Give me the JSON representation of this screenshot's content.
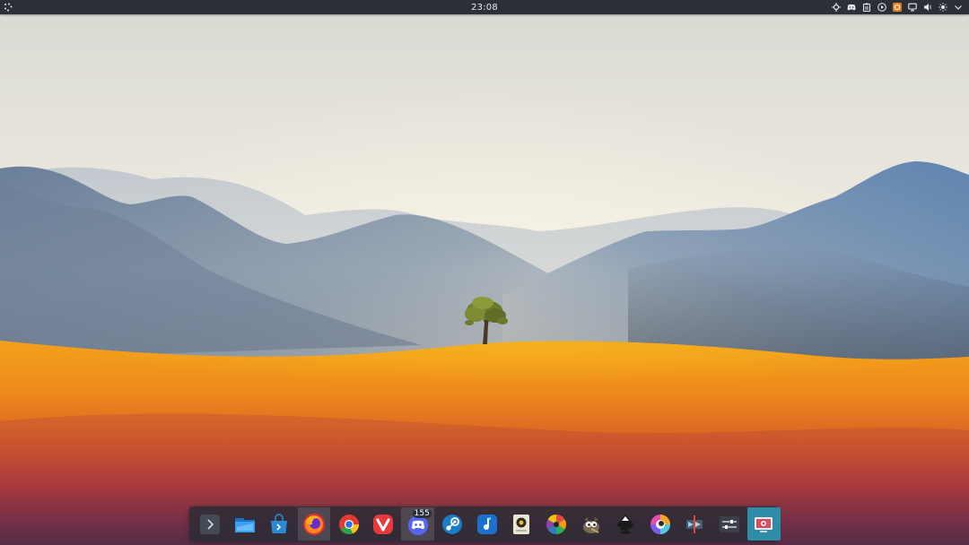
{
  "top_panel": {
    "clock": "23:08",
    "background": "#2b3036",
    "tray_icons": [
      "network-icon",
      "discord-tray-icon",
      "clipboard-icon",
      "media-player-icon",
      "orange-app-tray-icon",
      "display-icon",
      "volume-icon",
      "brightness-icon",
      "chevron-down-icon"
    ]
  },
  "dock": {
    "items": [
      {
        "name": "show-more-icon",
        "active": false
      },
      {
        "name": "file-manager-icon",
        "active": false
      },
      {
        "name": "app-store-icon",
        "active": false
      },
      {
        "name": "firefox-icon",
        "active": true
      },
      {
        "name": "chrome-icon",
        "active": false
      },
      {
        "name": "vivaldi-icon",
        "active": false
      },
      {
        "name": "discord-icon",
        "active": true,
        "badge": "155"
      },
      {
        "name": "steam-icon",
        "active": false
      },
      {
        "name": "music-app-icon",
        "active": false
      },
      {
        "name": "rhythmbox-icon",
        "active": false
      },
      {
        "name": "aperture-icon",
        "active": false
      },
      {
        "name": "gimp-icon",
        "active": false
      },
      {
        "name": "inkscape-icon",
        "active": false
      },
      {
        "name": "color-picker-icon",
        "active": false
      },
      {
        "name": "video-editor-icon",
        "active": false
      },
      {
        "name": "settings-sliders-icon",
        "active": false
      },
      {
        "name": "screenshot-tool-icon",
        "active": true
      }
    ],
    "discord_badge": "155"
  },
  "colors": {
    "sky_top": "#e9e6dc",
    "mountain": "#6e88a8",
    "desert_orange": "#f19f1f",
    "dock_focus": "#2e8ca8"
  }
}
